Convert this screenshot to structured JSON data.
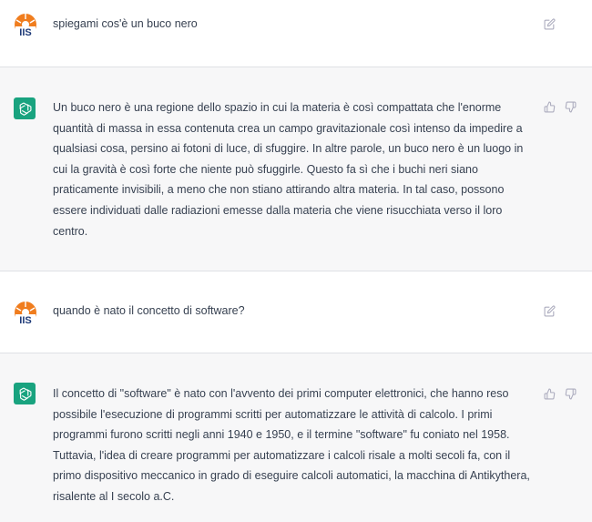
{
  "conversation": {
    "messages": [
      {
        "role": "user",
        "text": "spiegami cos'è un buco nero"
      },
      {
        "role": "assistant",
        "text": "Un buco nero è una regione dello spazio in cui la materia è così compattata che l'enorme quantità di massa in essa contenuta crea un campo gravitazionale così intenso da impedire a qualsiasi cosa, persino ai fotoni di luce, di sfuggire. In altre parole, un buco nero è un luogo in cui la gravità è così forte che niente può sfuggirle. Questo fa sì che i buchi neri siano praticamente invisibili, a meno che non stiano attirando altra materia. In tal caso, possono essere individuati dalle radiazioni emesse dalla materia che viene risucchiata verso il loro centro."
      },
      {
        "role": "user",
        "text": "quando è nato il concetto di software?"
      },
      {
        "role": "assistant",
        "text": "Il concetto di \"software\" è nato con l'avvento dei primi computer elettronici, che hanno reso possibile l'esecuzione di programmi scritti per automatizzare le attività di calcolo. I primi programmi furono scritti negli anni 1940 e 1950, e il termine \"software\" fu coniato nel 1958. Tuttavia, l'idea di creare programmi per automatizzare i calcoli risale a molti secoli fa, con il primo dispositivo meccanico in grado di eseguire calcoli automatici, la macchina di Antikythera, risalente al I secolo a.C."
      }
    ],
    "user_avatar": {
      "text": "IIS",
      "color": "#f07d1e"
    },
    "assistant_avatar": {
      "icon": "openai-logo-icon",
      "color": "#19a37f"
    },
    "icons": {
      "edit": "edit-icon",
      "thumbs_up": "thumbs-up-icon",
      "thumbs_down": "thumbs-down-icon"
    }
  }
}
